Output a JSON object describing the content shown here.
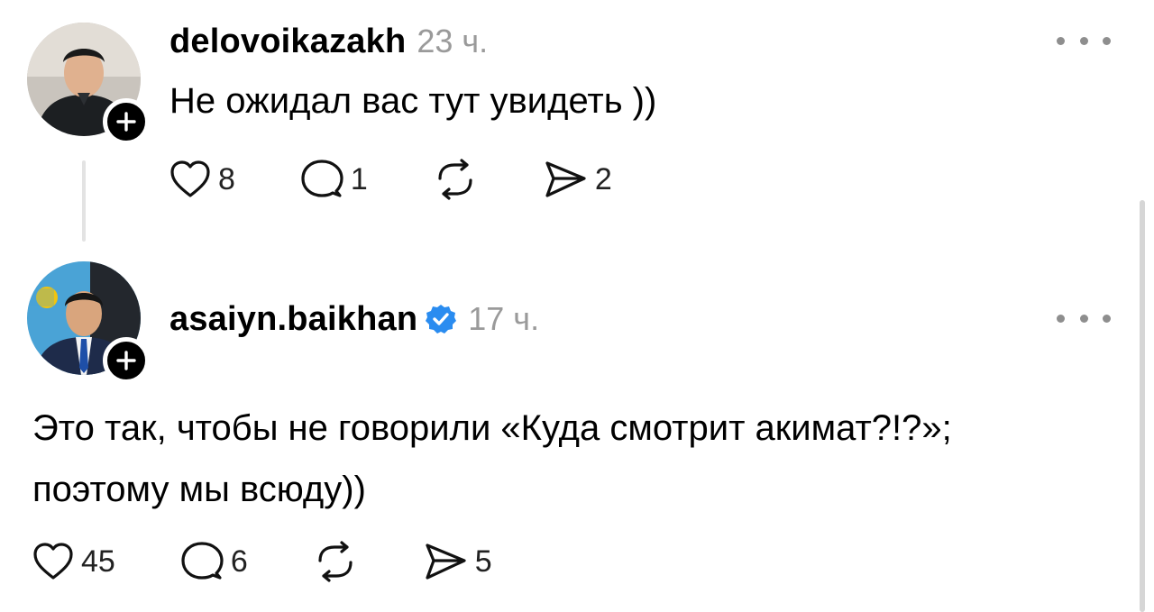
{
  "posts": [
    {
      "username": "delovoikazakh",
      "time": "23 ч.",
      "text": "Не ожидал вас тут увидеть ))",
      "likes": "8",
      "replies": "1",
      "shares": "2",
      "verified": false
    },
    {
      "username": "asaiyn.baikhan",
      "time": "17 ч.",
      "text_line1": "Это так, чтобы не говорили «Куда смотрит акимат?!?»;",
      "text_line2": "поэтому мы всюду))",
      "likes": "45",
      "replies": "6",
      "shares": "5",
      "verified": true
    }
  ],
  "icons": {
    "like": "heart-icon",
    "reply": "comment-icon",
    "repost": "repost-icon",
    "share": "send-icon",
    "more": "more-icon",
    "follow": "plus-icon",
    "verified": "verified-badge-icon"
  },
  "colors": {
    "verified": "#2a8cf0",
    "muted": "#9a9a9a",
    "text": "#000000"
  }
}
